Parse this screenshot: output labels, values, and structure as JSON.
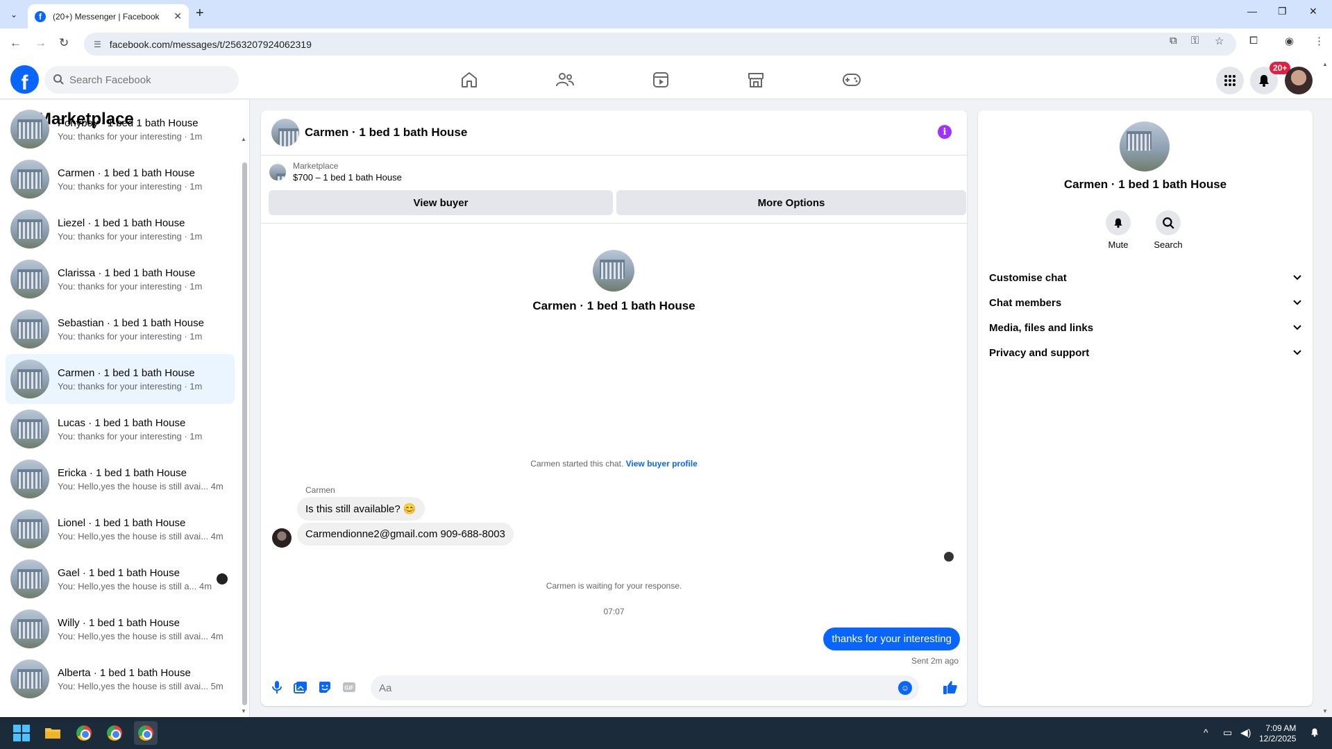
{
  "browser": {
    "tab_title": "(20+) Messenger | Facebook",
    "url": "facebook.com/messages/t/2563207924062319"
  },
  "fb": {
    "search_placeholder": "Search Facebook",
    "notification_badge": "20+",
    "brand_color": "#0866ff"
  },
  "left": {
    "title": "Marketplace",
    "conversations": [
      {
        "name": "Ponyboy · 1 bed 1 bath House",
        "snippet": "You: thanks for your interesting · 1m"
      },
      {
        "name": "Carmen · 1 bed 1 bath House",
        "snippet": "You: thanks for your interesting · 1m"
      },
      {
        "name": "Liezel · 1 bed 1 bath House",
        "snippet": "You: thanks for your interesting · 1m"
      },
      {
        "name": "Clarissa · 1 bed 1 bath House",
        "snippet": "You: thanks for your interesting · 1m"
      },
      {
        "name": "Sebastian · 1 bed 1 bath House",
        "snippet": "You: thanks for your interesting · 1m"
      },
      {
        "name": "Carmen · 1 bed 1 bath House",
        "snippet": "You: thanks for your interesting · 1m"
      },
      {
        "name": "Lucas · 1 bed 1 bath House",
        "snippet": "You: thanks for your interesting · 1m"
      },
      {
        "name": "Ericka · 1 bed 1 bath House",
        "snippet": "You: Hello,yes the house is still avai... 4m"
      },
      {
        "name": "Lionel · 1 bed 1 bath House",
        "snippet": "You: Hello,yes the house is still avai... 4m"
      },
      {
        "name": "Gael · 1 bed 1 bath House",
        "snippet": "You: Hello,yes the house is still a... 4m"
      },
      {
        "name": "Willy · 1 bed 1 bath House",
        "snippet": "You: Hello,yes the house is still avai... 4m"
      },
      {
        "name": "Alberta · 1 bed 1 bath House",
        "snippet": "You: Hello,yes the house is still avai... 5m"
      }
    ]
  },
  "chat": {
    "title": "Carmen · 1 bed 1 bath House",
    "listing_label": "Marketplace",
    "listing_price": "$700 – 1 bed 1 bath House",
    "view_buyer": "View buyer",
    "more_options": "More Options",
    "center_name": "Carmen · 1 bed 1 bath House",
    "started_text": "Carmen started this chat.",
    "view_buyer_profile": "View buyer profile",
    "sender": "Carmen",
    "msg1": "Is this still available? 😊",
    "msg2": "Carmendionne2@gmail.com 909-688-8003",
    "waiting": "Carmen is waiting for your response.",
    "time": "07:07",
    "reply": "thanks for your interesting",
    "sent": "Sent 2m ago",
    "composer_placeholder": "Aa"
  },
  "right": {
    "name": "Carmen · 1 bed 1 bath House",
    "mute": "Mute",
    "search": "Search",
    "sections": [
      "Customise chat",
      "Chat members",
      "Media, files and links",
      "Privacy and support"
    ]
  },
  "taskbar": {
    "time": "7:09 AM",
    "date": "12/2/2025"
  }
}
